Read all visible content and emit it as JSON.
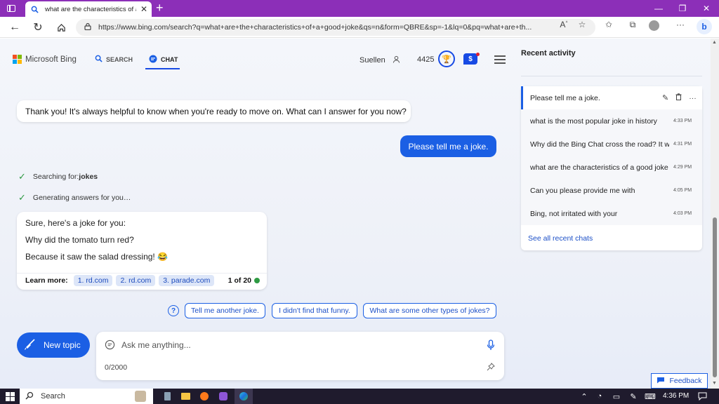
{
  "browser": {
    "tab_title": "what are the characteristics of a go",
    "url": "https://www.bing.com/search?q=what+are+the+characteristics+of+a+good+joke&qs=n&form=QBRE&sp=-1&lq=0&pq=what+are+th..."
  },
  "header": {
    "logo": "Microsoft Bing",
    "nav_search": "SEARCH",
    "nav_chat": "CHAT",
    "user_name": "Suellen",
    "points": "4425"
  },
  "chat": {
    "bot_msg_1": "Thank you! It's always helpful to know when you're ready to move on. What can I answer for you now?",
    "user_msg": "Please tell me a joke.",
    "status_1_prefix": "Searching for: ",
    "status_1_term": "jokes",
    "status_2": "Generating answers for you…",
    "answer_line_1": "Sure, here's a joke for you:",
    "answer_line_2": "Why did the tomato turn red?",
    "answer_line_3": "Because it saw the salad dressing! 😂",
    "learn_more_label": "Learn more:",
    "sources": [
      "1. rd.com",
      "2. rd.com",
      "3. parade.com"
    ],
    "response_count": "1 of 20"
  },
  "suggestions": [
    "Tell me another joke.",
    "I didn't find that funny.",
    "What are some other types of jokes?"
  ],
  "composer": {
    "new_topic": "New topic",
    "placeholder": "Ask me anything...",
    "char_count": "0/2000"
  },
  "sidebar": {
    "title": "Recent activity",
    "items": [
      {
        "text": "Please tell me a joke.",
        "time": ""
      },
      {
        "text": "what is the most popular joke in history",
        "time": "4:33 PM"
      },
      {
        "text": "Why did the Bing Chat cross the road? It was",
        "time": "4:31 PM"
      },
      {
        "text": "what are the characteristics of a good joke",
        "time": "4:29 PM"
      },
      {
        "text": "Can you please provide me with",
        "time": "4:05 PM"
      },
      {
        "text": "Bing, not irritated with your",
        "time": "4:03 PM"
      }
    ],
    "see_all": "See all recent chats"
  },
  "feedback": "Feedback",
  "taskbar": {
    "search": "Search",
    "time": "4:36 PM"
  },
  "colors": {
    "accent": "#1b5fe4",
    "titlebar": "#8c2fb8",
    "taskbar": "#1f1b2d"
  }
}
